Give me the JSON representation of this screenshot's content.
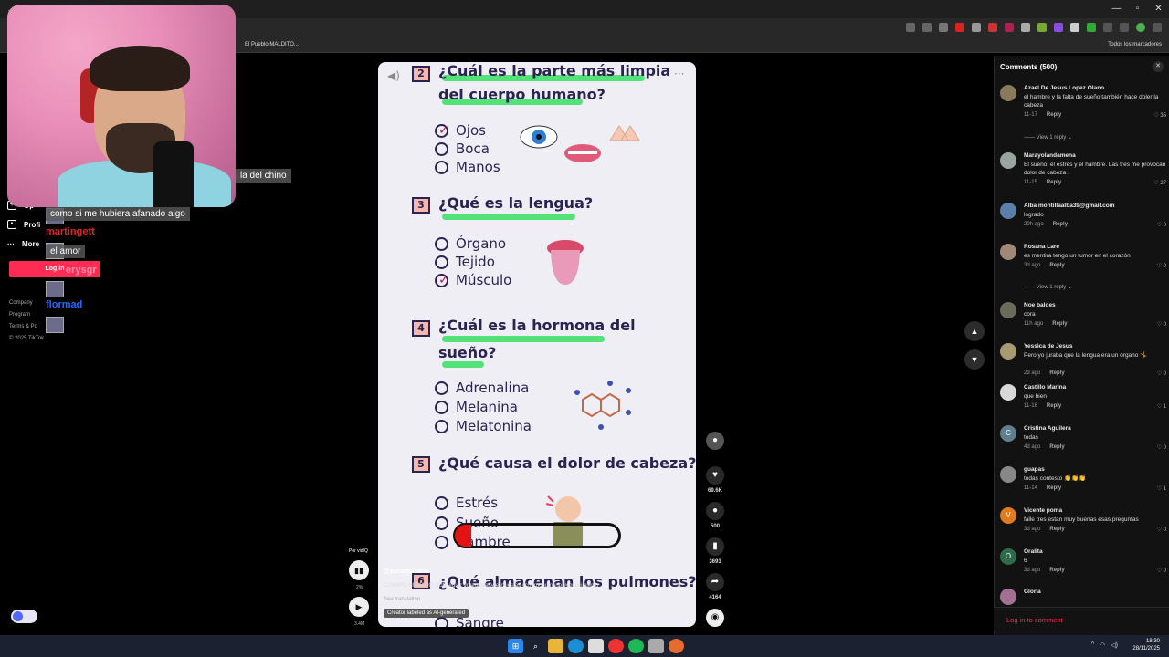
{
  "browser": {
    "bookmark_item": "El Pueblo MALDITO...",
    "all_bookmarks": "Todos los marcadores"
  },
  "stream": {
    "chat": [
      {
        "text": "la del chino"
      },
      {
        "text": "como si me hubiera afanado algo"
      },
      {
        "text": "el amor"
      }
    ],
    "users": [
      {
        "name": "martingett",
        "color": "#e0252f"
      },
      {
        "name": "erysgr",
        "color": "#ff8fa8"
      },
      {
        "name": "flormad",
        "color": "#1e6bff"
      }
    ]
  },
  "tiktok_nav": {
    "items": [
      "Op",
      "Profi",
      "More"
    ],
    "login": "Log in",
    "footer": [
      "Company",
      "Program",
      "Terms & Po",
      "© 2025 TikTok"
    ]
  },
  "video": {
    "questions": [
      {
        "num": "2",
        "line1": "¿Cuál es la parte más limpia",
        "line2": "del cuerpo humano?",
        "options": [
          "Ojos",
          "Boca",
          "Manos"
        ],
        "checked": 0
      },
      {
        "num": "3",
        "line1": "¿Qué es la lengua?",
        "line2": "",
        "options": [
          "Órgano",
          "Tejido",
          "Músculo"
        ],
        "checked": 2
      },
      {
        "num": "4",
        "line1": "¿Cuál es la hormona del",
        "line2": "sueño?",
        "options": [
          "Adrenalina",
          "Melanina",
          "Melatonina"
        ],
        "checked": -1
      },
      {
        "num": "5",
        "line1": "¿Qué causa el dolor de cabeza?",
        "line2": "",
        "options": [
          "Estrés",
          "Sueño",
          "Hambre"
        ],
        "checked": -1
      },
      {
        "num": "6",
        "line1": "¿Qué almacenan los pulmones?",
        "line2": "",
        "options": [
          "Sangre"
        ],
        "checked": -1
      }
    ],
    "uploader": "@pacaquizone",
    "caption": "CUERPO HUMANO QUIZ #quiz #preguntasyrespuestas #cuerpohumano #conocimiento",
    "see_translation": "See translation",
    "ai_label": "Creator labeled as AI-generated",
    "vidiq": "Por vidIQ",
    "stat_small": "2%",
    "time_small": "3.4M"
  },
  "actions": {
    "likes": "69.6K",
    "comments": "500",
    "saves": "3693",
    "shares": "4164"
  },
  "comments_panel": {
    "title": "Comments (500)",
    "login_prompt": "Log in to comment",
    "reply_label": "Reply",
    "view_replies": "View 1 reply",
    "items": [
      {
        "name": "Azael De Jesus Lopez Olano",
        "text": "el hambre y la falta de sueño también hace doler la cabeza",
        "date": "11-17",
        "likes": "35",
        "avatar": "#8a7a5c",
        "initial": ""
      },
      {
        "name": "Marayolandamena",
        "text": "El sueño, el estrés y el hambre. Las tres me provocan dolor de cabeza .",
        "date": "11-15",
        "likes": "27",
        "avatar": "#9aa5a0",
        "initial": ""
      },
      {
        "name": "Alba montillaalba39@gmail.com",
        "text": "logrado",
        "date": "20h ago",
        "likes": "0",
        "avatar": "#5a7fa8",
        "initial": ""
      },
      {
        "name": "Rosana Lare",
        "text": "es mentira tengo un tumor en el corazón",
        "date": "3d ago",
        "likes": "0",
        "avatar": "#a08878",
        "initial": ""
      },
      {
        "name": "Noe baldes",
        "text": "cora",
        "date": "11h ago",
        "likes": "0",
        "avatar": "#6b6b5a",
        "initial": ""
      },
      {
        "name": "Yessica de Jesus",
        "text": "Pero yo juraba que la lengua era un órgano 🤸",
        "date": "2d ago",
        "likes": "0",
        "avatar": "#a89a70",
        "initial": ""
      },
      {
        "name": "Castillo Marina",
        "text": "que bien",
        "date": "11-16",
        "likes": "1",
        "avatar": "#d8d8d8",
        "initial": ""
      },
      {
        "name": "Cristina Aguilera",
        "text": "todas",
        "date": "4d ago",
        "likes": "0",
        "avatar": "#5f7f8f",
        "initial": "C"
      },
      {
        "name": "guapas",
        "text": "todas contesto 👏👏👏",
        "date": "11-14",
        "likes": "1",
        "avatar": "#888888",
        "initial": ""
      },
      {
        "name": "Vicente poma",
        "text": "falle tres estan muy buenas esas preguntas",
        "date": "3d ago",
        "likes": "0",
        "avatar": "#e07b20",
        "initial": "V"
      },
      {
        "name": "Oralita",
        "text": "6",
        "date": "3d ago",
        "likes": "0",
        "avatar": "#2d6b4a",
        "initial": "O"
      },
      {
        "name": "Gloria",
        "text": "",
        "date": "",
        "likes": "",
        "avatar": "#a27090",
        "initial": ""
      }
    ]
  },
  "taskbar": {
    "time": "18:30",
    "date": "28/11/2025"
  }
}
